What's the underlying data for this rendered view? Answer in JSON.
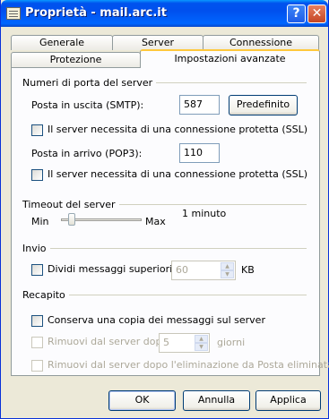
{
  "window": {
    "title": "Proprietà - mail.arc.it",
    "help_glyph": "?",
    "close_glyph": "✕"
  },
  "tabs": {
    "row1": [
      "Generale",
      "Server",
      "Connessione"
    ],
    "row2": [
      "Protezione",
      "Impostazioni avanzate"
    ],
    "active": "Impostazioni avanzate"
  },
  "ports": {
    "group_title": "Numeri di porta del server",
    "smtp_label": "Posta in uscita (SMTP):",
    "smtp_value": "587",
    "default_button": "Predefinito",
    "smtp_ssl_label": "Il server necessita di una connessione protetta (SSL)",
    "smtp_ssl_checked": false,
    "pop3_label": "Posta in arrivo (POP3):",
    "pop3_value": "110",
    "pop3_ssl_label": "Il server necessita di una connessione protetta (SSL)",
    "pop3_ssl_checked": false
  },
  "timeout": {
    "group_title": "Timeout del server",
    "min_label": "Min",
    "max_label": "Max",
    "value_text": "1 minuto",
    "slider_level": 0.1
  },
  "send": {
    "group_title": "Invio",
    "split_label": "Dividi messaggi superiori a",
    "split_checked": false,
    "split_value": "60",
    "split_unit": "KB"
  },
  "delivery": {
    "group_title": "Recapito",
    "keep_copy_label": "Conserva una copia dei messaggi sul server",
    "keep_copy_checked": false,
    "remove_after_label": "Rimuovi dal server dopo",
    "remove_after_value": "5",
    "remove_after_unit": "giorni",
    "remove_on_delete_label": "Rimuovi dal server dopo l'eliminazione da Posta eliminata"
  },
  "buttons": {
    "ok": "OK",
    "cancel": "Annulla",
    "apply": "Applica"
  }
}
